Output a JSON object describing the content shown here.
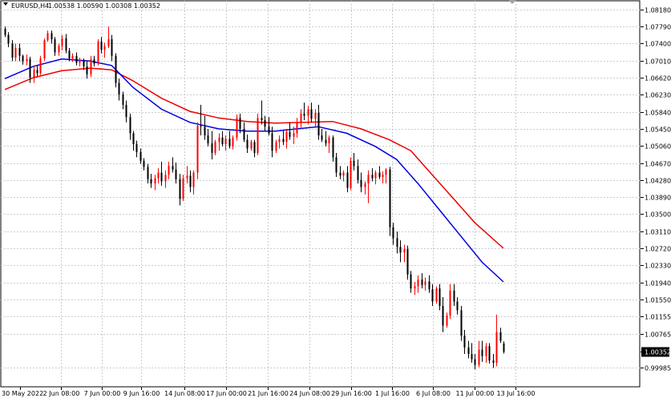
{
  "header": {
    "symbol_label": "EURUSD,H4",
    "ohlc_text": "1.00538 1.00590 1.00308 1.00352"
  },
  "colors": {
    "background": "#ffffff",
    "grid": "#c8ccd2",
    "bull": "#ff0000",
    "bear": "#000000",
    "ma_fast": "#0000dd",
    "ma_slow": "#ee0000",
    "price_tag_bg": "#000000",
    "price_tag_text": "#ffffff"
  },
  "chart_data": {
    "type": "candlestick",
    "title": "EURUSD,H4",
    "symbol": "EURUSD",
    "timeframe": "H4",
    "last_price": 1.00352,
    "ohlc_header": {
      "open": 1.00538,
      "high": 1.0059,
      "low": 1.00308,
      "close": 1.00352
    },
    "ylim": [
      0.9955,
      1.0838
    ],
    "y_ticks": [
      "1.08180",
      "1.07790",
      "1.07400",
      "1.07010",
      "1.06620",
      "1.06230",
      "1.05840",
      "1.05450",
      "1.05060",
      "1.04670",
      "1.04280",
      "1.03890",
      "1.03500",
      "1.03110",
      "1.02720",
      "1.02330",
      "1.01940",
      "1.01550",
      "1.01155",
      "1.00765",
      "1.00352",
      "0.99985"
    ],
    "x_ticks": [
      "30 May 2022",
      "2 Jun 08:00",
      "7 Jun 00:00",
      "9 Jun 16:00",
      "14 Jun 08:00",
      "17 Jun 00:00",
      "21 Jun 16:00",
      "24 Jun 08:00",
      "29 Jun 16:00",
      "1 Jul 16:00",
      "6 Jul 08:00",
      "11 Jul 00:00",
      "13 Jul 16:00"
    ],
    "grid": true,
    "candles": [
      [
        1.0774,
        1.0779,
        1.0755,
        1.076
      ],
      [
        1.076,
        1.0766,
        1.0732,
        1.074
      ],
      [
        1.074,
        1.0748,
        1.07,
        1.0708
      ],
      [
        1.0708,
        1.074,
        1.07,
        1.073
      ],
      [
        1.073,
        1.074,
        1.07,
        1.0712
      ],
      [
        1.0712,
        1.0715,
        1.0692,
        1.07
      ],
      [
        1.07,
        1.0715,
        1.069,
        1.0705
      ],
      [
        1.0705,
        1.071,
        1.065,
        1.0662
      ],
      [
        1.0662,
        1.069,
        1.065,
        1.068
      ],
      [
        1.068,
        1.069,
        1.0665,
        1.0672
      ],
      [
        1.0672,
        1.0712,
        1.0668,
        1.0706
      ],
      [
        1.0706,
        1.0752,
        1.07,
        1.0748
      ],
      [
        1.0748,
        1.077,
        1.0744,
        1.0764
      ],
      [
        1.0764,
        1.077,
        1.074,
        1.075
      ],
      [
        1.075,
        1.0755,
        1.0712,
        1.072
      ],
      [
        1.072,
        1.074,
        1.0712,
        1.0735
      ],
      [
        1.0735,
        1.076,
        1.0725,
        1.0752
      ],
      [
        1.0752,
        1.0762,
        1.0718,
        1.0724
      ],
      [
        1.0724,
        1.073,
        1.07,
        1.0706
      ],
      [
        1.0706,
        1.0718,
        1.0698,
        1.0712
      ],
      [
        1.0712,
        1.072,
        1.069,
        1.0696
      ],
      [
        1.0696,
        1.0708,
        1.0688,
        1.0702
      ],
      [
        1.0702,
        1.0706,
        1.068,
        1.0688
      ],
      [
        1.0688,
        1.07,
        1.066,
        1.067
      ],
      [
        1.067,
        1.0712,
        1.0664,
        1.0704
      ],
      [
        1.0704,
        1.0712,
        1.0688,
        1.0694
      ],
      [
        1.0694,
        1.075,
        1.069,
        1.0745
      ],
      [
        1.0745,
        1.0755,
        1.0718,
        1.0726
      ],
      [
        1.0726,
        1.0742,
        1.0708,
        1.0734
      ],
      [
        1.0734,
        1.0779,
        1.073,
        1.075
      ],
      [
        1.075,
        1.076,
        1.07,
        1.0712
      ],
      [
        1.0712,
        1.0718,
        1.064,
        1.065
      ],
      [
        1.065,
        1.066,
        1.061,
        1.0624
      ],
      [
        1.0624,
        1.063,
        1.059,
        1.06
      ],
      [
        1.06,
        1.061,
        1.056,
        1.0572
      ],
      [
        1.0572,
        1.058,
        1.052,
        1.0535
      ],
      [
        1.0535,
        1.054,
        1.0495,
        1.051
      ],
      [
        1.051,
        1.0518,
        1.048,
        1.0492
      ],
      [
        1.0492,
        1.05,
        1.0465,
        1.0472
      ],
      [
        1.0472,
        1.0478,
        1.045,
        1.0458
      ],
      [
        1.0458,
        1.0465,
        1.042,
        1.043
      ],
      [
        1.043,
        1.0442,
        1.041,
        1.042
      ],
      [
        1.042,
        1.044,
        1.0405,
        1.0432
      ],
      [
        1.0432,
        1.0455,
        1.042,
        1.0445
      ],
      [
        1.0445,
        1.047,
        1.0415,
        1.0425
      ],
      [
        1.0425,
        1.045,
        1.041,
        1.044
      ],
      [
        1.044,
        1.047,
        1.043,
        1.046
      ],
      [
        1.046,
        1.048,
        1.0445,
        1.0452
      ],
      [
        1.0452,
        1.0468,
        1.042,
        1.043
      ],
      [
        1.043,
        1.0442,
        1.037,
        1.0385
      ],
      [
        1.0385,
        1.044,
        1.038,
        1.0432
      ],
      [
        1.0432,
        1.046,
        1.042,
        1.0438
      ],
      [
        1.0438,
        1.045,
        1.04,
        1.0412
      ],
      [
        1.0412,
        1.045,
        1.0395,
        1.0445
      ],
      [
        1.0445,
        1.056,
        1.043,
        1.0552
      ],
      [
        1.0552,
        1.06,
        1.053,
        1.055
      ],
      [
        1.055,
        1.0575,
        1.052,
        1.053
      ],
      [
        1.053,
        1.0545,
        1.0505,
        1.0512
      ],
      [
        1.0512,
        1.054,
        1.0475,
        1.049
      ],
      [
        1.049,
        1.052,
        1.0485,
        1.0515
      ],
      [
        1.0515,
        1.0535,
        1.0495,
        1.0525
      ],
      [
        1.0525,
        1.054,
        1.0505,
        1.051
      ],
      [
        1.051,
        1.053,
        1.0495,
        1.0522
      ],
      [
        1.0522,
        1.054,
        1.05,
        1.0505
      ],
      [
        1.0505,
        1.053,
        1.0498,
        1.0525
      ],
      [
        1.0525,
        1.0578,
        1.0518,
        1.057
      ],
      [
        1.057,
        1.058,
        1.0535,
        1.0545
      ],
      [
        1.0545,
        1.056,
        1.0515,
        1.052
      ],
      [
        1.052,
        1.0532,
        1.049,
        1.05
      ],
      [
        1.05,
        1.052,
        1.0495,
        1.0515
      ],
      [
        1.0515,
        1.052,
        1.048,
        1.049
      ],
      [
        1.049,
        1.058,
        1.0485,
        1.057
      ],
      [
        1.057,
        1.061,
        1.0555,
        1.0565
      ],
      [
        1.0565,
        1.0575,
        1.054,
        1.055
      ],
      [
        1.055,
        1.0572,
        1.053,
        1.0535
      ],
      [
        1.0535,
        1.055,
        1.048,
        1.0495
      ],
      [
        1.0495,
        1.052,
        1.049,
        1.0515
      ],
      [
        1.0515,
        1.053,
        1.05,
        1.0522
      ],
      [
        1.0522,
        1.054,
        1.0508,
        1.0515
      ],
      [
        1.0515,
        1.0545,
        1.05,
        1.0538
      ],
      [
        1.0538,
        1.056,
        1.052,
        1.0527
      ],
      [
        1.0527,
        1.055,
        1.051,
        1.0535
      ],
      [
        1.0535,
        1.057,
        1.0525,
        1.056
      ],
      [
        1.056,
        1.059,
        1.0548,
        1.058
      ],
      [
        1.058,
        1.0605,
        1.0565,
        1.0575
      ],
      [
        1.0575,
        1.0598,
        1.0555,
        1.059
      ],
      [
        1.059,
        1.0605,
        1.056,
        1.0568
      ],
      [
        1.0568,
        1.059,
        1.055,
        1.0582
      ],
      [
        1.0582,
        1.06,
        1.052,
        1.053
      ],
      [
        1.053,
        1.0545,
        1.0515,
        1.052
      ],
      [
        1.052,
        1.054,
        1.0505,
        1.0512
      ],
      [
        1.0512,
        1.053,
        1.049,
        1.0525
      ],
      [
        1.0525,
        1.053,
        1.047,
        1.048
      ],
      [
        1.048,
        1.049,
        1.0435,
        1.0445
      ],
      [
        1.0445,
        1.046,
        1.043,
        1.0438
      ],
      [
        1.0438,
        1.045,
        1.0425,
        1.0445
      ],
      [
        1.0445,
        1.046,
        1.04,
        1.041
      ],
      [
        1.041,
        1.048,
        1.0405,
        1.0472
      ],
      [
        1.0472,
        1.049,
        1.045,
        1.046
      ],
      [
        1.046,
        1.0475,
        1.042,
        1.0428
      ],
      [
        1.0428,
        1.0445,
        1.04,
        1.0412
      ],
      [
        1.0412,
        1.0425,
        1.0395,
        1.042
      ],
      [
        1.042,
        1.045,
        1.0375,
        1.044
      ],
      [
        1.044,
        1.0455,
        1.0425,
        1.0432
      ],
      [
        1.0432,
        1.045,
        1.0418,
        1.0445
      ],
      [
        1.0445,
        1.046,
        1.043,
        1.0435
      ],
      [
        1.0435,
        1.0448,
        1.042,
        1.044
      ],
      [
        1.044,
        1.0455,
        1.042,
        1.0452
      ],
      [
        1.0452,
        1.0458,
        1.03,
        1.032
      ],
      [
        1.032,
        1.033,
        1.028,
        1.0295
      ],
      [
        1.0295,
        1.031,
        1.026,
        1.0275
      ],
      [
        1.0275,
        1.029,
        1.024,
        1.0262
      ],
      [
        1.0262,
        1.028,
        1.024,
        1.027
      ],
      [
        1.027,
        1.0278,
        1.02,
        1.0212
      ],
      [
        1.0212,
        1.022,
        1.017,
        1.018
      ],
      [
        1.018,
        1.0195,
        1.0165,
        1.0185
      ],
      [
        1.0185,
        1.021,
        1.017,
        1.02
      ],
      [
        1.02,
        1.0215,
        1.018,
        1.0188
      ],
      [
        1.0188,
        1.0205,
        1.0175,
        1.0196
      ],
      [
        1.0196,
        1.021,
        1.017,
        1.0178
      ],
      [
        1.0178,
        1.019,
        1.014,
        1.015
      ],
      [
        1.015,
        1.0185,
        1.0145,
        1.018
      ],
      [
        1.018,
        1.019,
        1.013,
        1.014
      ],
      [
        1.014,
        1.016,
        1.008,
        1.0095
      ],
      [
        1.0095,
        1.0125,
        1.009,
        1.0118
      ],
      [
        1.0118,
        1.019,
        1.011,
        1.0175
      ],
      [
        1.0175,
        1.019,
        1.014,
        1.015
      ],
      [
        1.015,
        1.016,
        1.012,
        1.013
      ],
      [
        1.013,
        1.014,
        1.006,
        1.0072
      ],
      [
        1.0072,
        1.0085,
        1.003,
        1.0045
      ],
      [
        1.0045,
        1.006,
        1.002,
        1.003
      ],
      [
        1.003,
        1.0055,
        1.001,
        1.0018
      ],
      [
        1.0018,
        1.003,
        0.9995,
        1.0005
      ],
      [
        1.0005,
        1.006,
        1.0,
        1.004
      ],
      [
        1.004,
        1.006,
        1.0012,
        1.0025
      ],
      [
        1.0025,
        1.0055,
        1.001,
        1.0048
      ],
      [
        1.0048,
        1.0055,
        1.0008,
        1.0015
      ],
      [
        1.0015,
        1.003,
        0.9998,
        1.001
      ],
      [
        1.001,
        1.012,
        1.0002,
        1.008
      ],
      [
        1.008,
        1.009,
        1.0055,
        1.006
      ],
      [
        1.0054,
        1.0059,
        1.0031,
        1.0035
      ]
    ],
    "ma_fast_points": [
      [
        0,
        1.066
      ],
      [
        8,
        1.0688
      ],
      [
        16,
        1.0705
      ],
      [
        24,
        1.07
      ],
      [
        30,
        1.069
      ],
      [
        36,
        1.064
      ],
      [
        44,
        1.059
      ],
      [
        52,
        1.056
      ],
      [
        60,
        1.0545
      ],
      [
        68,
        1.054
      ],
      [
        76,
        1.054
      ],
      [
        82,
        1.0545
      ],
      [
        88,
        1.055
      ],
      [
        96,
        1.0535
      ],
      [
        104,
        1.0505
      ],
      [
        110,
        1.0475
      ],
      [
        116,
        1.042
      ],
      [
        122,
        1.036
      ],
      [
        128,
        1.03
      ],
      [
        134,
        1.024
      ],
      [
        140,
        1.0195
      ]
    ],
    "ma_slow_points": [
      [
        0,
        1.0635
      ],
      [
        8,
        1.0662
      ],
      [
        16,
        1.0678
      ],
      [
        24,
        1.0684
      ],
      [
        30,
        1.068
      ],
      [
        36,
        1.0655
      ],
      [
        44,
        1.0615
      ],
      [
        52,
        1.0585
      ],
      [
        60,
        1.057
      ],
      [
        68,
        1.0562
      ],
      [
        76,
        1.0558
      ],
      [
        84,
        1.056
      ],
      [
        92,
        1.0562
      ],
      [
        100,
        1.0545
      ],
      [
        108,
        1.052
      ],
      [
        114,
        1.0495
      ],
      [
        120,
        1.044
      ],
      [
        126,
        1.0385
      ],
      [
        132,
        1.033
      ],
      [
        140,
        1.0272
      ]
    ]
  }
}
